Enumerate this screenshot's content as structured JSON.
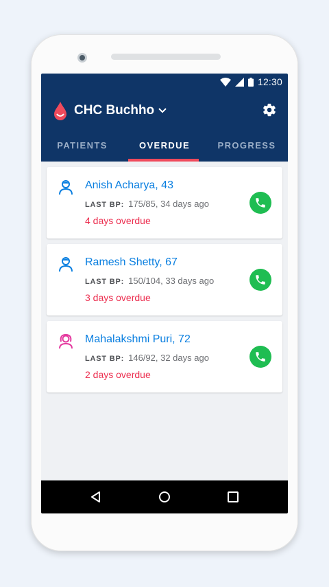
{
  "status_bar": {
    "time": "12:30"
  },
  "header": {
    "facility": "CHC Buchho"
  },
  "tabs": [
    {
      "label": "PATIENTS",
      "active": false
    },
    {
      "label": "OVERDUE",
      "active": true
    },
    {
      "label": "PROGRESS",
      "active": false
    }
  ],
  "patients": [
    {
      "name": "Anish Acharya, 43",
      "bp_label": "LAST BP:",
      "bp": "175/85, 34 days ago",
      "overdue": "4 days overdue",
      "gender": "male"
    },
    {
      "name": "Ramesh Shetty, 67",
      "bp_label": "LAST BP:",
      "bp": "150/104, 33 days ago",
      "overdue": "3 days overdue",
      "gender": "male"
    },
    {
      "name": "Mahalakshmi Puri, 72",
      "bp_label": "LAST BP:",
      "bp": "146/92, 32 days ago",
      "overdue": "2 days overdue",
      "gender": "female"
    }
  ],
  "icons": {
    "logo": "blood-drop-icon",
    "settings": "gear-icon",
    "call": "phone-icon",
    "male": "male-patient-icon",
    "female": "female-patient-icon"
  },
  "colors": {
    "appbar": "#0f3567",
    "accent": "#ef4a5c",
    "link": "#0a7fe0",
    "overdue": "#ec2e4f",
    "call": "#1fbd52",
    "female": "#e4389e"
  }
}
